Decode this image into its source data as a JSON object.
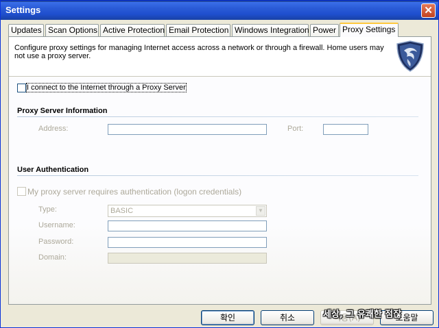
{
  "window": {
    "title": "Settings",
    "close_glyph": "✕"
  },
  "tabs": [
    {
      "label": "Updates"
    },
    {
      "label": "Scan Options"
    },
    {
      "label": "Active Protection"
    },
    {
      "label": "Email Protection"
    },
    {
      "label": "Windows Integration"
    },
    {
      "label": "Power"
    },
    {
      "label": "Proxy Settings",
      "active": true
    }
  ],
  "header": {
    "description": "Configure proxy settings for managing Internet access across a network or through a firewall.  Home users may not use a proxy server.",
    "logo_icon": "shield-logo-icon"
  },
  "proxy": {
    "use_proxy_label": "I connect to the Internet through a Proxy Server",
    "use_proxy_checked": false,
    "section_title": "Proxy Server Information",
    "address_label": "Address:",
    "address_value": "",
    "port_label": "Port:",
    "port_value": ""
  },
  "auth": {
    "section_title": "User Authentication",
    "requires_auth_label": "My proxy server requires authentication (logon credentials)",
    "requires_auth_checked": false,
    "type_label": "Type:",
    "type_value": "BASIC",
    "username_label": "Username:",
    "username_value": "",
    "password_label": "Password:",
    "password_value": "",
    "domain_label": "Domain:",
    "domain_value": ""
  },
  "buttons": {
    "ok": "확인",
    "cancel": "취소",
    "apply": "적용(A)",
    "help": "도움말"
  },
  "watermark": "세상, 그 유쾌한 점잖",
  "colors": {
    "title_bar": "#2a5bd7",
    "close_button": "#c1411f",
    "active_tab_accent": "#ffc83c"
  }
}
